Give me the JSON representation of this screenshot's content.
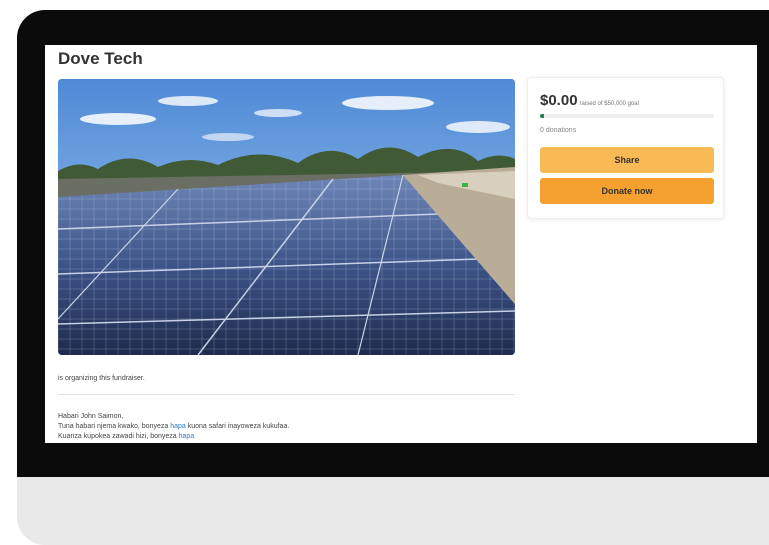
{
  "page": {
    "title": "Dove Tech",
    "organizer_text": "is organizing this fundraiser."
  },
  "story": {
    "line1": "Habari John Saimon,",
    "line2_before": "Tuna habari njema kwako, bonyeza ",
    "line2_link": "hapa",
    "line2_after": " kuona safari inayoweza kukufaa.",
    "line3_before": "Kuanza kupokea zawadi hizi, bonyeza ",
    "line3_link": "hapa"
  },
  "donation_card": {
    "amount": "$0.00",
    "goal_text": "raised of $50,000 goal",
    "progress_fraction": 0.0,
    "donations_text": "0 donations",
    "share_label": "Share",
    "donate_label": "Donate now"
  },
  "colors": {
    "share_button": "#f9ba55",
    "donate_button": "#f4a12f",
    "progress": "#1f8a55",
    "link": "#2b7bd6"
  },
  "hero_image": {
    "icon": "solar-panels-photo"
  }
}
